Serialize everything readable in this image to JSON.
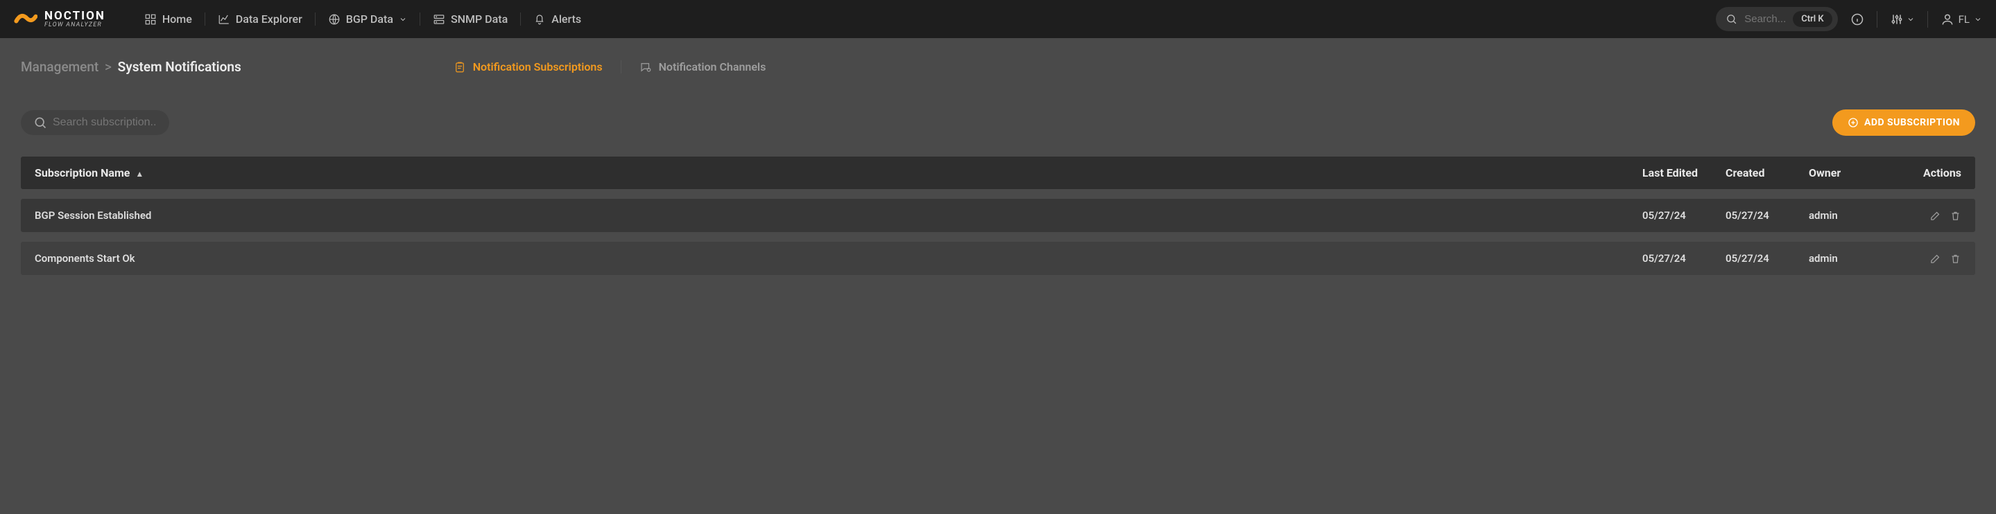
{
  "brand": {
    "name": "NOCTION",
    "tagline": "FLOW ANALYZER"
  },
  "nav": {
    "home": "Home",
    "data_explorer": "Data Explorer",
    "bgp_data": "BGP Data",
    "snmp_data": "SNMP Data",
    "alerts": "Alerts"
  },
  "header_search": {
    "placeholder": "Search...",
    "shortcut": "Ctrl K"
  },
  "user": "FL",
  "breadcrumb": {
    "root": "Management",
    "current": "System Notifications"
  },
  "tabs": {
    "subscriptions": "Notification Subscriptions",
    "channels": "Notification Channels"
  },
  "toolbar": {
    "search_placeholder": "Search subscription...",
    "add_label": "ADD SUBSCRIPTION"
  },
  "columns": {
    "name": "Subscription Name",
    "last_edited": "Last Edited",
    "created": "Created",
    "owner": "Owner",
    "actions": "Actions"
  },
  "rows": [
    {
      "name": "BGP Session Established",
      "last_edited": "05/27/24",
      "created": "05/27/24",
      "owner": "admin"
    },
    {
      "name": "Components Start Ok",
      "last_edited": "05/27/24",
      "created": "05/27/24",
      "owner": "admin"
    }
  ]
}
